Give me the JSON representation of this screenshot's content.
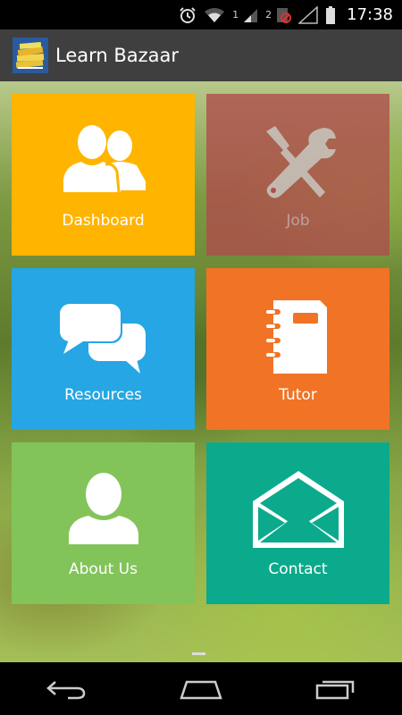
{
  "status_bar": {
    "time": "17:38",
    "sim1_label": "1",
    "sim2_label": "2",
    "icons": [
      "alarm-icon",
      "wifi-icon",
      "signal-sim1-icon",
      "signal-sim2-icon",
      "no-data-icon",
      "signal-icon",
      "battery-icon"
    ]
  },
  "action_bar": {
    "title": "Learn Bazaar",
    "logo": "books-logo-icon"
  },
  "tiles": [
    {
      "label": "Dashboard",
      "icon": "users-icon",
      "color": "#ffb400"
    },
    {
      "label": "Job",
      "icon": "tools-icon",
      "color": "#b04c4c"
    },
    {
      "label": "Resources",
      "icon": "chat-bubbles-icon",
      "color": "#26a6e4"
    },
    {
      "label": "Tutor",
      "icon": "notebook-icon",
      "color": "#f17325"
    },
    {
      "label": "About Us",
      "icon": "user-icon",
      "color": "#82c45a"
    },
    {
      "label": "Contact",
      "icon": "envelope-icon",
      "color": "#0caa8c"
    }
  ],
  "nav_bar": {
    "icons": [
      "back-icon",
      "home-icon",
      "recents-icon"
    ]
  }
}
